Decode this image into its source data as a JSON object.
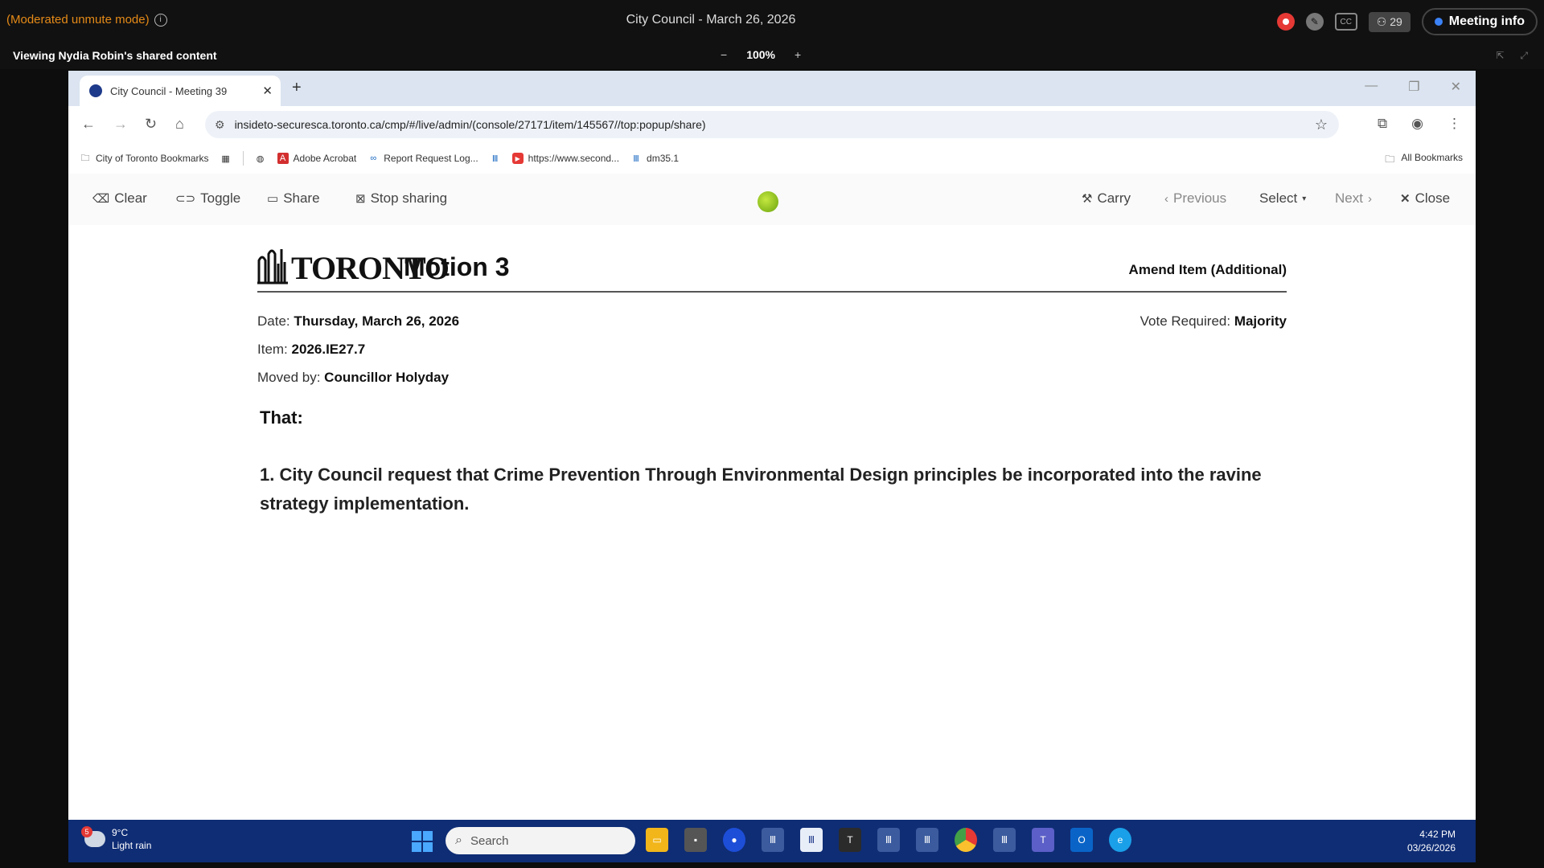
{
  "meeting_bar": {
    "mode_text": "(Moderated unmute mode)",
    "title": "City Council - March 26, 2026",
    "cc_label": "CC",
    "participants_count": "29",
    "meeting_info_label": "Meeting info"
  },
  "view_bar": {
    "viewing_text": "Viewing Nydia Robin's shared content",
    "zoom_out": "−",
    "zoom_value": "100%",
    "zoom_in": "+"
  },
  "browser": {
    "tab_title": "City Council - Meeting 39",
    "tab_close": "✕",
    "new_tab": "+",
    "url": "insideto-securesca.toronto.ca/cmp/#/live/admin/(console/27171/item/145567//top:popup/share)",
    "bookmarks": [
      {
        "label": "City of Toronto Bookmarks",
        "icon": "folder-icon"
      },
      {
        "label": "",
        "icon": "apps-grid-icon"
      },
      {
        "label": "",
        "icon": "globe-icon"
      },
      {
        "label": "Adobe Acrobat",
        "icon": "acrobat-icon"
      },
      {
        "label": "Report Request Log...",
        "icon": "link-icon"
      },
      {
        "label": "",
        "icon": "toronto-icon"
      },
      {
        "label": "https://www.second...",
        "icon": "youtube-icon"
      },
      {
        "label": "dm35.1",
        "icon": "toronto-icon"
      }
    ],
    "all_bookmarks": "All Bookmarks"
  },
  "toolbar": {
    "clear": "Clear",
    "toggle": "Toggle",
    "share": "Share",
    "stop_sharing": "Stop sharing",
    "carry": "Carry",
    "previous": "Previous",
    "select": "Select",
    "next": "Next",
    "close": "Close"
  },
  "motion": {
    "logo_text": "TORONTO",
    "title": "Motion 3",
    "type": "Amend Item (Additional)",
    "date_label": "Date:",
    "date_value": "Thursday, March 26, 2026",
    "vote_label": "Vote Required:",
    "vote_value": "Majority",
    "item_label": "Item:",
    "item_value": "2026.IE27.7",
    "moved_label": "Moved by:",
    "moved_value": "Councillor Holyday",
    "that": "That:",
    "text": "1. City Council request that Crime Prevention Through Environmental Design principles be incorporated into the ravine strategy implementation."
  },
  "taskbar": {
    "weather_badge": "5",
    "temperature": "9°C",
    "condition": "Light rain",
    "search_placeholder": "Search",
    "time": "4:42 PM",
    "date": "03/26/2026"
  },
  "colors": {
    "accent_orange": "#e58a17",
    "taskbar_blue": "#0f2d75",
    "record_red": "#e53935"
  }
}
